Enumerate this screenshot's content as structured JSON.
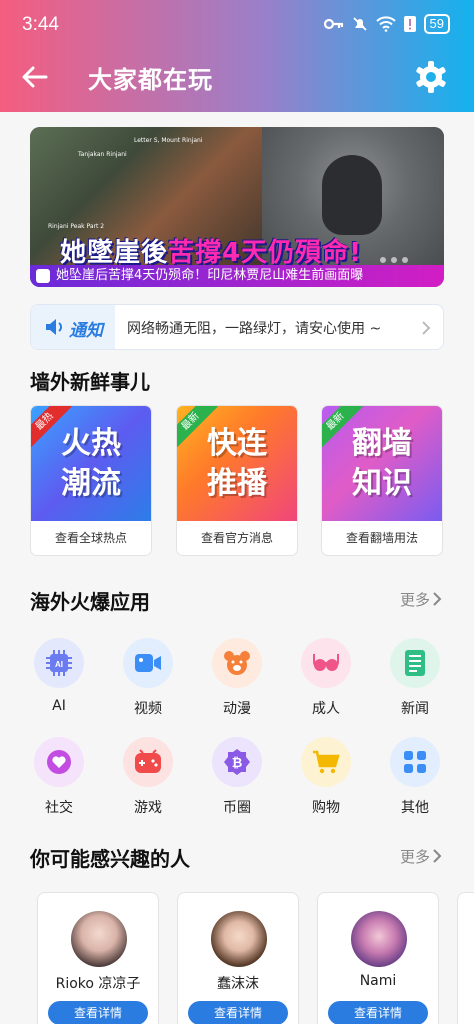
{
  "status_bar": {
    "time": "3:44",
    "battery": "59"
  },
  "header": {
    "title": "大家都在玩"
  },
  "banner": {
    "headline_a": "她墜崖後",
    "headline_b": "苦撐4天仍殞命!",
    "caption": "她坠崖后苦撑4天仍殒命！印尼林贾尼山难生前画面曝",
    "map_labels": [
      "Rinjani Peak Part 2",
      "Letter S, Mount Rinjani",
      "Tanjakan Rinjani"
    ]
  },
  "notice": {
    "tag": "通知",
    "text": "网络畅通无阻，一路绿灯，请安心使用 ~"
  },
  "fresh": {
    "title": "墙外新鲜事儿",
    "cards": [
      {
        "ribbon": "最热",
        "line1": "火热",
        "line2": "潮流",
        "label": "查看全球热点"
      },
      {
        "ribbon": "最新",
        "line1": "快连",
        "line2": "推播",
        "label": "查看官方消息"
      },
      {
        "ribbon": "最新",
        "line1": "翻墙",
        "line2": "知识",
        "label": "查看翻墙用法"
      }
    ]
  },
  "apps": {
    "title": "海外火爆应用",
    "more": "更多",
    "items": [
      {
        "label": "AI",
        "icon": "ai-chip-icon",
        "color": "#6b7cf0"
      },
      {
        "label": "视频",
        "icon": "video-camera-icon",
        "color": "#3a8ef5"
      },
      {
        "label": "动漫",
        "icon": "bear-face-icon",
        "color": "#f5803a"
      },
      {
        "label": "成人",
        "icon": "lingerie-icon",
        "color": "#f0558a"
      },
      {
        "label": "新闻",
        "icon": "newspaper-icon",
        "color": "#2fbf86"
      },
      {
        "label": "社交",
        "icon": "heart-bubble-icon",
        "color": "#c24de0"
      },
      {
        "label": "游戏",
        "icon": "gamepad-icon",
        "color": "#f04a4a"
      },
      {
        "label": "币圈",
        "icon": "bitcoin-icon",
        "color": "#8a5ae6"
      },
      {
        "label": "购物",
        "icon": "shopping-cart-icon",
        "color": "#f5b800"
      },
      {
        "label": "其他",
        "icon": "grid-icon",
        "color": "#3a8ef5"
      }
    ]
  },
  "people": {
    "title": "你可能感兴趣的人",
    "more": "更多",
    "items": [
      {
        "name": "Rioko 凉凉子",
        "button": "查看详情"
      },
      {
        "name": "蠢沫沫",
        "button": "查看详情"
      },
      {
        "name": "Nami",
        "button": "查看详情"
      }
    ]
  }
}
